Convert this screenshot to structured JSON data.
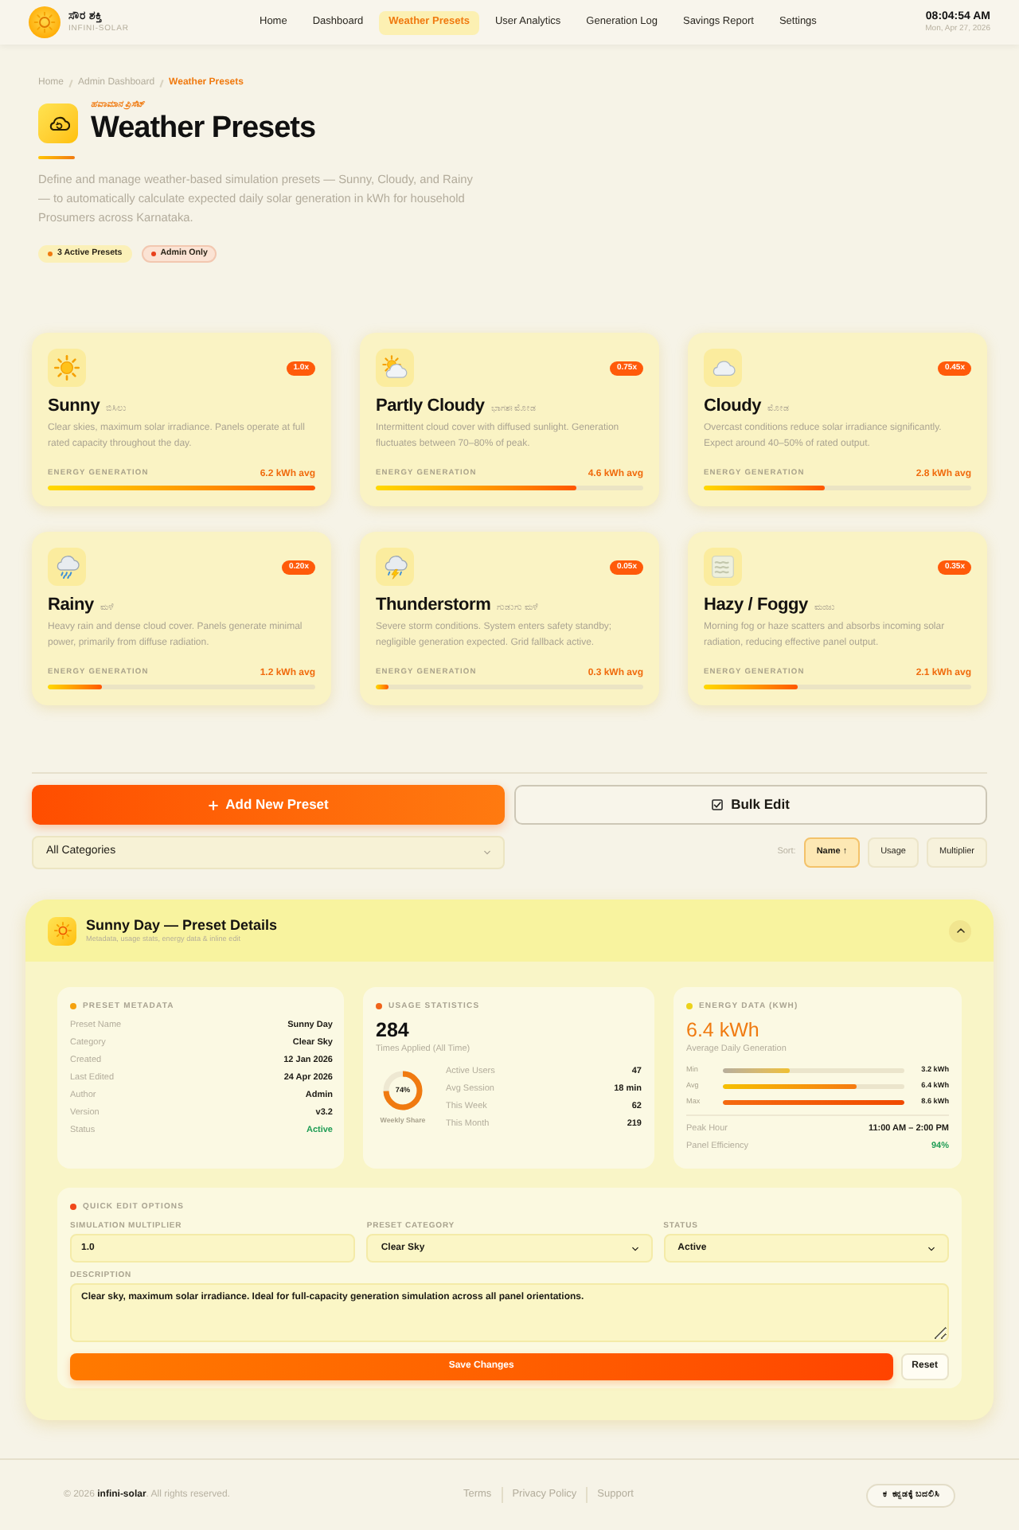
{
  "header": {
    "brand": {
      "name": "ಸೌರ ಶಕ್ತಿ",
      "tagline": "INFINI-SOLAR"
    },
    "nav": [
      {
        "label": "Home",
        "selected": false
      },
      {
        "label": "Dashboard",
        "selected": false
      },
      {
        "label": "Weather Presets",
        "selected": true
      },
      {
        "label": "User Analytics",
        "selected": false
      },
      {
        "label": "Generation Log",
        "selected": false
      },
      {
        "label": "Savings Report",
        "selected": false
      },
      {
        "label": "Settings",
        "selected": false
      }
    ],
    "clock": {
      "time": "08:04:54 AM",
      "date": "Mon, Apr 27, 2026"
    }
  },
  "breadcrumb": [
    {
      "label": "Home",
      "selected": false
    },
    {
      "label": "Admin Dashboard",
      "selected": false
    },
    {
      "label": "Weather Presets",
      "selected": true
    }
  ],
  "page": {
    "kicker": "ಹವಾಮಾನ ಪ್ರಿಸೆಟ್",
    "title": "Weather Presets",
    "description": "Define and manage weather-based simulation presets — Sunny, Cloudy, and Rainy — to automatically calculate expected daily solar generation in kWh for household Prosumers across Karnataka.",
    "badges": [
      {
        "label": "3 Active Presets",
        "kind": "active"
      },
      {
        "label": "Admin Only",
        "kind": "admin"
      }
    ]
  },
  "presets": [
    {
      "kind": "sunny",
      "name": "Sunny",
      "local_name": "ಬಿಸಿಲು",
      "multiplier": "1.0x",
      "description": "Clear skies, maximum solar irradiance. Panels operate at full rated capacity throughout the day.",
      "energy_label": "ENERGY GENERATION",
      "energy_value": "6.2 kWh avg",
      "level": 1.0
    },
    {
      "kind": "partly_cloudy",
      "name": "Partly Cloudy",
      "local_name": "ಭಾಗಶಃ ಮೋಡ",
      "multiplier": "0.75x",
      "description": "Intermittent cloud cover with diffused sunlight. Generation fluctuates between 70–80% of peak.",
      "energy_label": "ENERGY GENERATION",
      "energy_value": "4.6 kWh avg",
      "level": 0.75
    },
    {
      "kind": "cloudy",
      "name": "Cloudy",
      "local_name": "ಮೋಡ",
      "multiplier": "0.45x",
      "description": "Overcast conditions reduce solar irradiance significantly. Expect around 40–50% of rated output.",
      "energy_label": "ENERGY GENERATION",
      "energy_value": "2.8 kWh avg",
      "level": 0.45
    },
    {
      "kind": "rainy",
      "name": "Rainy",
      "local_name": "ಮಳೆ",
      "multiplier": "0.20x",
      "description": "Heavy rain and dense cloud cover. Panels generate minimal power, primarily from diffuse radiation.",
      "energy_label": "ENERGY GENERATION",
      "energy_value": "1.2 kWh avg",
      "level": 0.2
    },
    {
      "kind": "storm",
      "name": "Thunderstorm",
      "local_name": "ಗುಡುಗು ಮಳೆ",
      "multiplier": "0.05x",
      "description": "Severe storm conditions. System enters safety standby; negligible generation expected. Grid fallback active.",
      "energy_label": "ENERGY GENERATION",
      "energy_value": "0.3 kWh avg",
      "level": 0.05
    },
    {
      "kind": "fog",
      "name": "Hazy / Foggy",
      "local_name": "ಮಂಜು",
      "multiplier": "0.35x",
      "description": "Morning fog or haze scatters and absorbs incoming solar radiation, reducing effective panel output.",
      "energy_label": "ENERGY GENERATION",
      "energy_value": "2.1 kWh avg",
      "level": 0.35
    }
  ],
  "actions": {
    "add_button": "Add New Preset",
    "bulk_button": "Bulk Edit"
  },
  "filter": {
    "category": {
      "value": "All Categories"
    },
    "sort_label": "Sort:",
    "sort_options": [
      {
        "label": "Name ↑",
        "selected": true
      },
      {
        "label": "Usage",
        "selected": false
      },
      {
        "label": "Multiplier",
        "selected": false
      }
    ]
  },
  "details": {
    "title": "Sunny Day — Preset Details",
    "subtitle": "Metadata, usage stats, energy data & inline edit",
    "expanded": true,
    "metadata": {
      "heading": "PRESET METADATA",
      "rows": [
        {
          "label": "Preset Name",
          "value": "Sunny Day",
          "kind": "text"
        },
        {
          "label": "Category",
          "value": "Clear Sky",
          "kind": "text"
        },
        {
          "label": "Created",
          "value": "12 Jan 2026",
          "kind": "text"
        },
        {
          "label": "Last Edited",
          "value": "24 Apr 2026",
          "kind": "text"
        },
        {
          "label": "Author",
          "value": "Admin",
          "kind": "text"
        },
        {
          "label": "Version",
          "value": "v3.2",
          "kind": "text"
        },
        {
          "label": "Status",
          "value": "Active",
          "kind": "good"
        }
      ]
    },
    "usage": {
      "heading": "USAGE STATISTICS",
      "total": "284",
      "total_label": "Times Applied (All Time)",
      "share": {
        "reading": "74%",
        "label": "Weekly Share",
        "level": 0.74
      },
      "rows": [
        {
          "label": "Active Users",
          "value": "47"
        },
        {
          "label": "Avg Session",
          "value": "18 min"
        },
        {
          "label": "This Week",
          "value": "62"
        },
        {
          "label": "This Month",
          "value": "219"
        }
      ]
    },
    "energy": {
      "heading": "ENERGY DATA (KWH)",
      "average": "6.4 kWh",
      "average_label": "Average Daily Generation",
      "bars": [
        {
          "label": "Min",
          "reading": "3.2 kWh",
          "level": 0.37,
          "kind": "min"
        },
        {
          "label": "Avg",
          "reading": "6.4 kWh",
          "level": 0.74,
          "kind": "avg"
        },
        {
          "label": "Max",
          "reading": "8.6 kWh",
          "level": 1.0,
          "kind": "max"
        }
      ],
      "rows": [
        {
          "label": "Peak Hour",
          "value": "11:00 AM – 2:00 PM",
          "kind": "text"
        },
        {
          "label": "Panel Efficiency",
          "value": "94%",
          "kind": "good"
        }
      ]
    },
    "quick_edit": {
      "heading": "QUICK EDIT OPTIONS",
      "fields": [
        {
          "label": "SIMULATION MULTIPLIER",
          "value": "1.0",
          "kind": "input"
        },
        {
          "label": "PRESET CATEGORY",
          "value": "Clear Sky",
          "kind": "select"
        },
        {
          "label": "STATUS",
          "value": "Active",
          "kind": "select"
        }
      ],
      "description_label": "DESCRIPTION",
      "description": "Clear sky, maximum solar irradiance. Ideal for full-capacity generation simulation across all panel orientations.",
      "save_button": "Save Changes",
      "reset_button": "Reset"
    }
  },
  "footer": {
    "copyright": "© 2026 **infini-solar**. All rights reserved.",
    "links": [
      "Terms",
      "Privacy Policy",
      "Support"
    ],
    "language_button": {
      "glyph": "ಕ",
      "label": "ಕನ್ನಡಕ್ಕೆ ಬದಲಿಸಿ"
    }
  }
}
